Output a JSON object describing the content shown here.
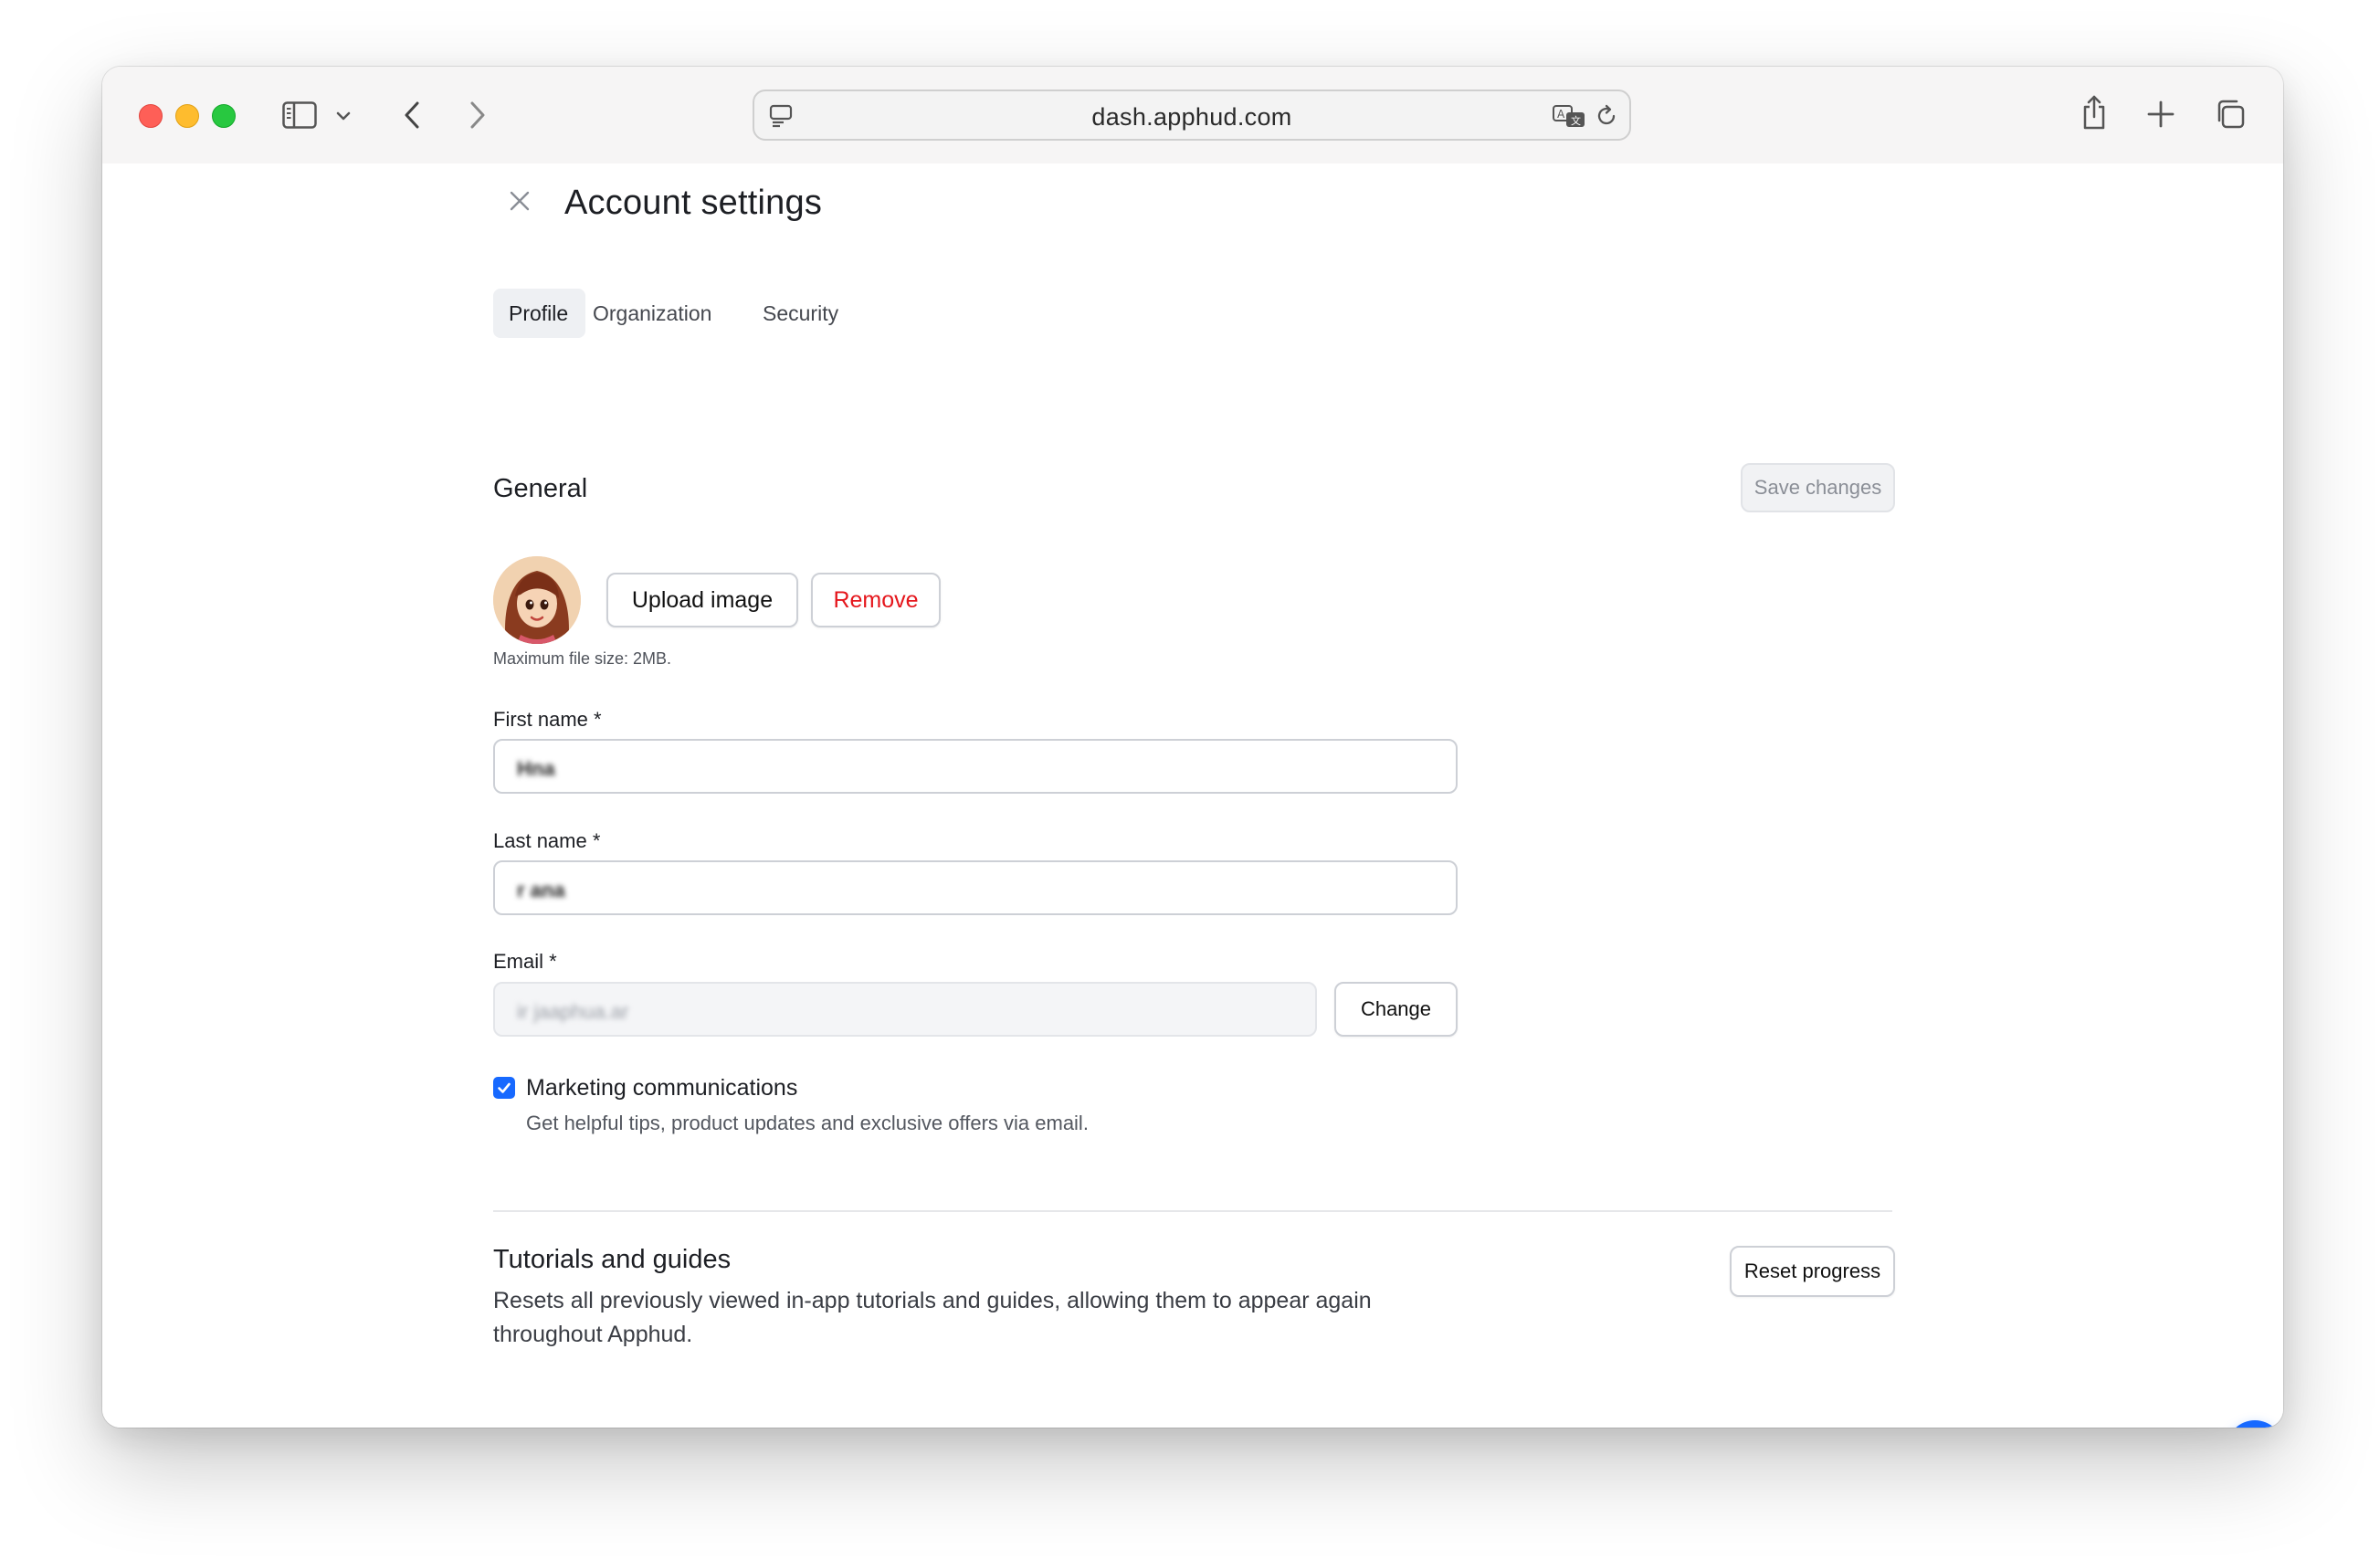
{
  "browser": {
    "url": "dash.apphud.com"
  },
  "page": {
    "title": "Account settings"
  },
  "tabs": [
    {
      "label": "Profile",
      "active": true
    },
    {
      "label": "Organization",
      "active": false
    },
    {
      "label": "Security",
      "active": false
    }
  ],
  "general": {
    "title": "General",
    "save_label": "Save changes",
    "upload_label": "Upload image",
    "remove_label": "Remove",
    "file_hint": "Maximum file size: 2MB.",
    "first_name_label": "First name *",
    "first_name_value": "Hna",
    "last_name_label": "Last name *",
    "last_name_value": "r  ana",
    "email_label": "Email *",
    "email_value": "ir   jaaphua.ar",
    "change_label": "Change",
    "marketing_label": "Marketing communications",
    "marketing_checked": true,
    "marketing_desc": "Get helpful tips, product updates and exclusive offers via email."
  },
  "tutorials": {
    "title": "Tutorials and guides",
    "desc_line1": "Resets all previously viewed in-app tutorials and guides, allowing them to appear again",
    "desc_line2": "throughout Apphud.",
    "reset_label": "Reset progress"
  },
  "colors": {
    "accent": "#1769ff",
    "danger": "#e5161c"
  }
}
